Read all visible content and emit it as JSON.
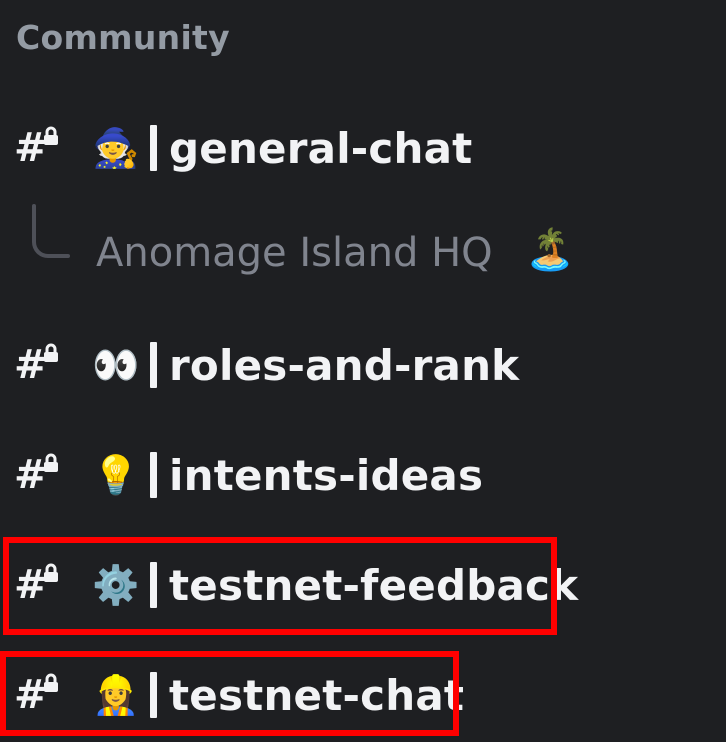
{
  "category": {
    "label": "Community"
  },
  "thread": {
    "name": "Anomage Island HQ",
    "emoji": "🏝️"
  },
  "channels": [
    {
      "emoji": "🧙",
      "name": "general-chat"
    },
    {
      "emoji": "👀",
      "name": "roles-and-rank"
    },
    {
      "emoji": "💡",
      "name": "intents-ideas"
    },
    {
      "emoji": "⚙️",
      "name": "testnet-feedback",
      "highlighted": true
    },
    {
      "emoji": "👷‍♀️",
      "name": "testnet-chat",
      "highlighted": true
    }
  ],
  "colors": {
    "background": "#1e1f22",
    "channel_text": "#f2f3f5",
    "category_text": "#949ba4",
    "thread_text": "#80848e",
    "highlight": "#ff0000"
  },
  "icons": {
    "channel_type": "locked-text-channel-icon",
    "thread_spine": "thread-spine-icon"
  }
}
